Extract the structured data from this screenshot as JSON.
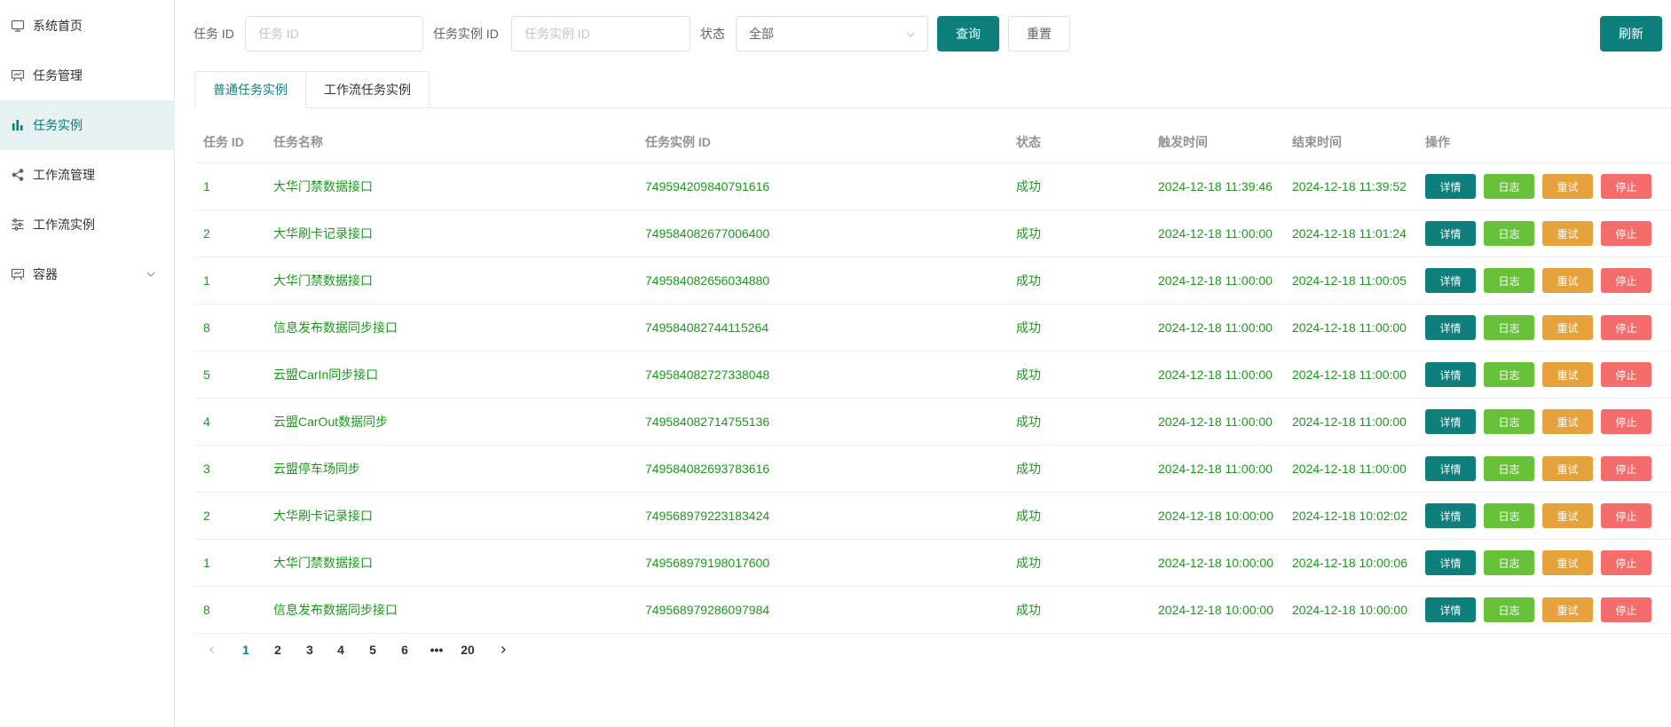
{
  "sidebar": {
    "items": [
      {
        "label": "系统首页",
        "icon": "monitor-icon",
        "active": false
      },
      {
        "label": "任务管理",
        "icon": "presentation-icon",
        "active": false
      },
      {
        "label": "任务实例",
        "icon": "bar-chart-icon",
        "active": true
      },
      {
        "label": "工作流管理",
        "icon": "share-icon",
        "active": false
      },
      {
        "label": "工作流实例",
        "icon": "sliders-icon",
        "active": false
      },
      {
        "label": "容器",
        "icon": "presentation-icon",
        "active": false,
        "expandable": true
      }
    ]
  },
  "filters": {
    "task_id_label": "任务 ID",
    "task_id_placeholder": "任务 ID",
    "instance_id_label": "任务实例 ID",
    "instance_id_placeholder": "任务实例 ID",
    "status_label": "状态",
    "status_value": "全部",
    "query_button": "查询",
    "reset_button": "重置",
    "refresh_button": "刷新"
  },
  "tabs": [
    {
      "label": "普通任务实例",
      "active": true
    },
    {
      "label": "工作流任务实例",
      "active": false
    }
  ],
  "table": {
    "columns": [
      "任务 ID",
      "任务名称",
      "任务实例 ID",
      "状态",
      "触发时间",
      "结束时间",
      "操作"
    ],
    "action_labels": {
      "detail": "详情",
      "log": "日志",
      "retry": "重试",
      "stop": "停止"
    },
    "rows": [
      {
        "task_id": "1",
        "name": "大华门禁数据接口",
        "instance_id": "749594209840791616",
        "status": "成功",
        "trigger": "2024-12-18 11:39:46",
        "end": "2024-12-18 11:39:52"
      },
      {
        "task_id": "2",
        "name": "大华刷卡记录接口",
        "instance_id": "749584082677006400",
        "status": "成功",
        "trigger": "2024-12-18 11:00:00",
        "end": "2024-12-18 11:01:24"
      },
      {
        "task_id": "1",
        "name": "大华门禁数据接口",
        "instance_id": "749584082656034880",
        "status": "成功",
        "trigger": "2024-12-18 11:00:00",
        "end": "2024-12-18 11:00:05"
      },
      {
        "task_id": "8",
        "name": "信息发布数据同步接口",
        "instance_id": "749584082744115264",
        "status": "成功",
        "trigger": "2024-12-18 11:00:00",
        "end": "2024-12-18 11:00:00"
      },
      {
        "task_id": "5",
        "name": "云盟CarIn同步接口",
        "instance_id": "749584082727338048",
        "status": "成功",
        "trigger": "2024-12-18 11:00:00",
        "end": "2024-12-18 11:00:00"
      },
      {
        "task_id": "4",
        "name": "云盟CarOut数据同步",
        "instance_id": "749584082714755136",
        "status": "成功",
        "trigger": "2024-12-18 11:00:00",
        "end": "2024-12-18 11:00:00"
      },
      {
        "task_id": "3",
        "name": "云盟停车场同步",
        "instance_id": "749584082693783616",
        "status": "成功",
        "trigger": "2024-12-18 11:00:00",
        "end": "2024-12-18 11:00:00"
      },
      {
        "task_id": "2",
        "name": "大华刷卡记录接口",
        "instance_id": "749568979223183424",
        "status": "成功",
        "trigger": "2024-12-18 10:00:00",
        "end": "2024-12-18 10:02:02"
      },
      {
        "task_id": "1",
        "name": "大华门禁数据接口",
        "instance_id": "749568979198017600",
        "status": "成功",
        "trigger": "2024-12-18 10:00:00",
        "end": "2024-12-18 10:00:06"
      },
      {
        "task_id": "8",
        "name": "信息发布数据同步接口",
        "instance_id": "749568979286097984",
        "status": "成功",
        "trigger": "2024-12-18 10:00:00",
        "end": "2024-12-18 10:00:00"
      }
    ]
  },
  "pagination": {
    "pages": [
      "1",
      "2",
      "3",
      "4",
      "5",
      "6",
      "•••",
      "20"
    ],
    "current": "1"
  },
  "colors": {
    "primary": "#0e7f7b",
    "success_text": "#1a9a1a",
    "log": "#67c23a",
    "retry": "#e6a23c",
    "stop": "#f56c6c"
  }
}
